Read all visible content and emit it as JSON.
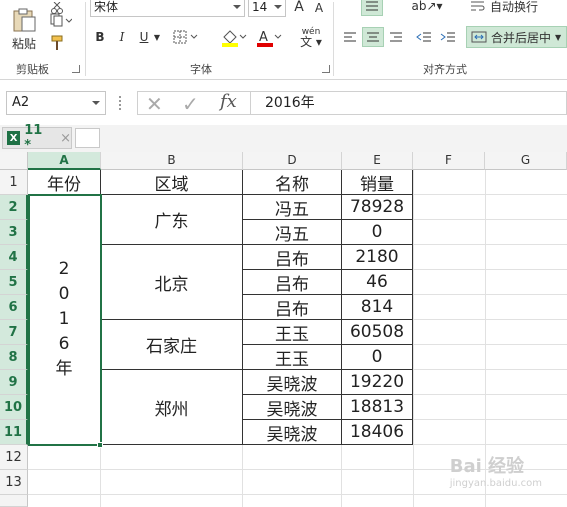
{
  "ribbon": {
    "clipboard": {
      "paste_label": "粘贴",
      "group_label": "剪贴板"
    },
    "font": {
      "font_name": "宋体",
      "font_size": "14",
      "group_label": "字体",
      "bold": "B",
      "italic": "I",
      "underline": "U",
      "wen_label": "wén"
    },
    "alignment": {
      "wrap_label": "自动换行",
      "merge_label": "合并后居中",
      "group_label": "对齐方式"
    }
  },
  "formula_bar": {
    "name_box": "A2",
    "fx_label": "fx",
    "content": "2016年"
  },
  "tab": {
    "label": "11 *",
    "close": "×"
  },
  "columns": [
    "A",
    "B",
    "D",
    "E",
    "F",
    "G"
  ],
  "rows": [
    "1",
    "2",
    "3",
    "4",
    "5",
    "6",
    "7",
    "8",
    "9",
    "10",
    "11",
    "12",
    "13"
  ],
  "table": {
    "headers": {
      "year": "年份",
      "region": "区域",
      "name": "名称",
      "sales": "销量"
    },
    "year_vertical": [
      "2",
      "0",
      "1",
      "6",
      "年"
    ],
    "regions": [
      "广东",
      "北京",
      "石家庄",
      "郑州"
    ],
    "names": [
      "冯五",
      "冯五",
      "吕布",
      "吕布",
      "吕布",
      "王玉",
      "王玉",
      "吴晓波",
      "吴晓波",
      "吴晓波"
    ],
    "sales": [
      "78928",
      "0",
      "2180",
      "46",
      "814",
      "60508",
      "0",
      "19220",
      "18813",
      "18406"
    ]
  },
  "watermark": {
    "main": "Bai 经验",
    "sub": "jingyan.baidu.com"
  },
  "colors": {
    "accent": "#217346",
    "highlight": "#cfe8d6"
  }
}
